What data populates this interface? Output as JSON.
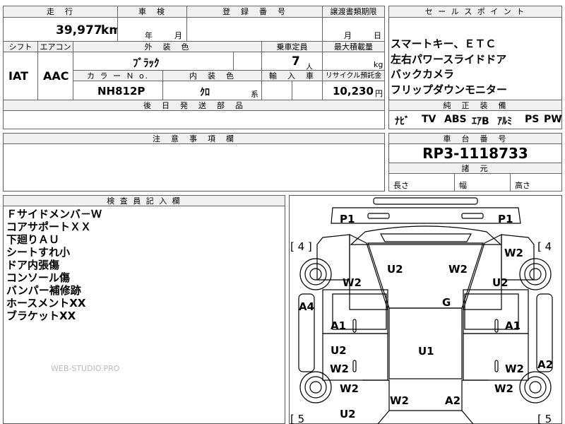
{
  "top": {
    "mileage_header": "走　行",
    "mileage_value": "39,977",
    "mileage_unit": "km",
    "inspection_header": "車　検",
    "inspection_year": "年",
    "inspection_month": "月",
    "registration_header": "登　録　番　号",
    "transfer_header": "譲渡書類期限",
    "transfer_month": "月",
    "transfer_day": "日"
  },
  "row2": {
    "shift_header": "シフト",
    "ac_header": "エアコン",
    "shift_value": "IAT",
    "ac_value": "AAC",
    "exterior_header": "外　装　色",
    "exterior_value": "ﾌﾞﾗｯｸ",
    "capacity_header": "乗車定員",
    "capacity_value": "7",
    "capacity_unit": "人",
    "maxload_header": "最大積載量",
    "maxload_unit": "kg",
    "color_no_header": "カ ラ ー Ｎ o.",
    "color_no_value": "NH812P",
    "interior_header": "内　装　色",
    "interior_value": "ｸﾛ",
    "interior_unit": "系",
    "import_header": "輸　入　車",
    "recycle_header": "リサイクル預託金",
    "recycle_value": "10,230",
    "recycle_unit": "円",
    "parts_header": "後　日　発　送　部　品"
  },
  "sales": {
    "header": "セ ー ル ス ポ イ ン ト",
    "points": [
      "スマートキー、ＥＴＣ",
      "左右パワースライドドア",
      "バックカメラ",
      "フリップダウンモニター"
    ],
    "equip_header": "純　正　装　備",
    "equipment": [
      "ﾅﾋﾞ",
      "TV",
      "ABS",
      "ｴｱB",
      "ｱﾙﾐ",
      "PS",
      "PW"
    ]
  },
  "notes": {
    "header": "注　意　事　項　欄"
  },
  "chassis": {
    "header": "車　台　番　号",
    "number": "RP3-1118733",
    "dims_header": "諸　元",
    "length": "長さ",
    "width": "幅",
    "height": "高さ"
  },
  "inspector": {
    "header": "検 査 員 記 入 欄",
    "items": [
      "Ｆサイドメンバ－Ｗ",
      "コアサポートＸＸ",
      "下廻りＡＵ",
      "シートすれ小",
      "ドア内張傷",
      "コンソール傷",
      "バンパー補修跡",
      "ホースメントXX",
      "ブラケットXX"
    ]
  },
  "watermark": "WEB-STUDIO.PRO",
  "diagram": {
    "p1_left": "P1",
    "p1_right": "P1",
    "b4_left": "[ 4 ]",
    "b4_right": "[ 4",
    "w2_front_r": "W2",
    "u2_front_l": "U2",
    "w2_front_c": "W2",
    "w2_left": "W2",
    "u2_right": "U2",
    "a4": "A4",
    "g": "G",
    "a1_left": "A1",
    "a1_right": "A1",
    "u2_left_door": "U2",
    "u1": "U1",
    "w2_left_door": "W2",
    "w2_right_door": "W2",
    "a2_right": "A2",
    "w2_left_rear": "W2",
    "w2_right_rear": "W2",
    "w2_rear_c": "W2",
    "a2_rear": "A2",
    "u2_rear": "U2",
    "b5_left": "[ 5",
    "b5_right": "[ 5"
  }
}
